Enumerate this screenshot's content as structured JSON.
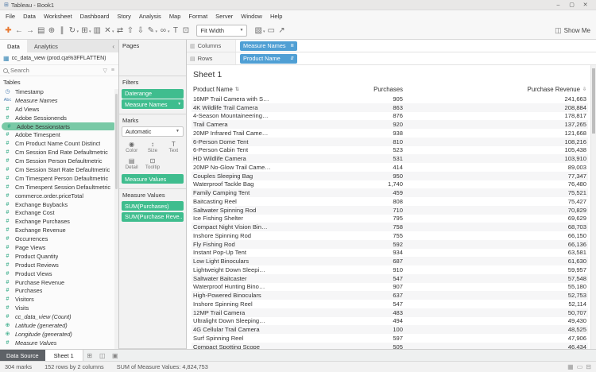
{
  "colors": {
    "green_pill": "#3fbd8e",
    "blue_pill": "#4f9fd4",
    "selected_field_bg": "#79c9a6",
    "measure_icon": "#1ca078",
    "dimension_icon": "#4a7db1"
  },
  "window": {
    "title": "Tableau - Book1"
  },
  "window_controls": {
    "minimize": "–",
    "maximize": "▢",
    "close": "✕"
  },
  "menu": {
    "items": [
      "File",
      "Data",
      "Worksheet",
      "Dashboard",
      "Story",
      "Analysis",
      "Map",
      "Format",
      "Server",
      "Window",
      "Help"
    ]
  },
  "toolbar": {
    "icons_left": [
      {
        "name": "tableau-logo-icon",
        "glyph": "✚",
        "color": "#e8762d"
      },
      {
        "name": "undo-icon",
        "glyph": "←"
      },
      {
        "name": "redo-icon",
        "glyph": "→"
      },
      {
        "name": "save-icon",
        "glyph": "▤"
      },
      {
        "name": "add-data-icon",
        "glyph": "⊕"
      },
      {
        "name": "pause-updates-icon",
        "glyph": "∥"
      },
      {
        "name": "run-update-icon",
        "glyph": "↻",
        "dropdown": true
      },
      {
        "name": "new-worksheet-icon",
        "glyph": "⊞",
        "dropdown": true
      },
      {
        "name": "duplicate-sheet-icon",
        "glyph": "▥"
      },
      {
        "name": "clear-sheet-icon",
        "glyph": "✕",
        "dropdown": true
      },
      {
        "name": "swap-axes-icon",
        "glyph": "⇄"
      },
      {
        "name": "sort-ascending-icon",
        "glyph": "⇧"
      },
      {
        "name": "sort-descending-icon",
        "glyph": "⇩"
      },
      {
        "name": "highlight-icon",
        "glyph": "✎",
        "dropdown": true
      },
      {
        "name": "group-members-icon",
        "glyph": "∞",
        "dropdown": true
      },
      {
        "name": "show-mark-labels-icon",
        "glyph": "T"
      },
      {
        "name": "fix-axes-icon",
        "glyph": "⊡"
      }
    ],
    "fit": {
      "label": "Fit Width"
    },
    "icons_right": [
      {
        "name": "show-hide-cards-icon",
        "glyph": "▧",
        "dropdown": true
      },
      {
        "name": "presentation-mode-icon",
        "glyph": "▭"
      },
      {
        "name": "share-icon",
        "glyph": "↗"
      }
    ],
    "show_me": {
      "label": "Show Me",
      "icon_glyph": "◫"
    }
  },
  "data_panel": {
    "tabs": [
      {
        "label": "Data"
      },
      {
        "label": "Analytics"
      }
    ],
    "collapse_glyph": "‹",
    "datasource": {
      "label": "cc_data_view (prod.cja%3FFLATTEN)"
    },
    "search": {
      "placeholder": "Search"
    },
    "tables_label": "Tables",
    "fields": [
      {
        "icon": "datetime",
        "label": "Timestamp"
      },
      {
        "icon": "abc",
        "label": "Measure Names",
        "italic": true
      },
      {
        "icon": "number",
        "label": "Ad Views"
      },
      {
        "icon": "number",
        "label": "Adobe Sessionends"
      },
      {
        "icon": "number",
        "label": "Adobe Sessionstarts",
        "selected": true
      },
      {
        "icon": "number",
        "label": "Adobe Timespent"
      },
      {
        "icon": "number",
        "label": "Cm Product Name Count Distinct"
      },
      {
        "icon": "number",
        "label": "Cm Session End Rate Defaultmetric"
      },
      {
        "icon": "number",
        "label": "Cm Session Person Defaultmetric"
      },
      {
        "icon": "number",
        "label": "Cm Session Start Rate Defaultmetric"
      },
      {
        "icon": "number",
        "label": "Cm Timespent Person Defaultmetric"
      },
      {
        "icon": "number",
        "label": "Cm Timespent Session Defaultmetric"
      },
      {
        "icon": "number",
        "label": "commerce.order.priceTotal"
      },
      {
        "icon": "number",
        "label": "Exchange Buybacks"
      },
      {
        "icon": "number",
        "label": "Exchange Cost"
      },
      {
        "icon": "number",
        "label": "Exchange Purchases"
      },
      {
        "icon": "number",
        "label": "Exchange Revenue"
      },
      {
        "icon": "number",
        "label": "Occurrences"
      },
      {
        "icon": "number",
        "label": "Page Views"
      },
      {
        "icon": "number",
        "label": "Product Quantity"
      },
      {
        "icon": "number",
        "label": "Product Reviews"
      },
      {
        "icon": "number",
        "label": "Product Views"
      },
      {
        "icon": "number",
        "label": "Purchase Revenue"
      },
      {
        "icon": "number",
        "label": "Purchases"
      },
      {
        "icon": "number",
        "label": "Visitors"
      },
      {
        "icon": "number",
        "label": "Visits"
      },
      {
        "icon": "number",
        "label": "cc_data_view (Count)",
        "italic": true
      },
      {
        "icon": "globe",
        "label": "Latitude (generated)",
        "italic": true
      },
      {
        "icon": "globe",
        "label": "Longitude (generated)",
        "italic": true
      },
      {
        "icon": "number",
        "label": "Measure Values",
        "italic": true
      }
    ]
  },
  "cards": {
    "pages": {
      "label": "Pages"
    },
    "filters": {
      "label": "Filters",
      "pills": [
        {
          "label": "Daterange"
        },
        {
          "label": "Measure Names",
          "icon": "filter"
        }
      ]
    },
    "marks": {
      "label": "Marks",
      "mark_type": "Automatic",
      "buttons": [
        {
          "name": "color-button",
          "label": "Color",
          "glyph": "◉"
        },
        {
          "name": "size-button",
          "label": "Size",
          "glyph": "↕"
        },
        {
          "name": "text-button",
          "label": "Text",
          "glyph": "T"
        },
        {
          "name": "detail-button",
          "label": "Detail",
          "glyph": "▤"
        },
        {
          "name": "tooltip-button",
          "label": "Tooltip",
          "glyph": "⊡"
        }
      ],
      "pill": {
        "label": "Measure Values"
      }
    },
    "measure_values_card": {
      "label": "Measure Values",
      "pills": [
        {
          "label": "SUM(Purchases)"
        },
        {
          "label": "SUM(Purchase Reve.."
        }
      ]
    }
  },
  "columns_shelf": {
    "label": "Columns",
    "pills": [
      {
        "label": "Measure Names"
      }
    ]
  },
  "rows_shelf": {
    "label": "Rows",
    "pills": [
      {
        "label": "Product Name"
      }
    ]
  },
  "sheet": {
    "title": "Sheet 1"
  },
  "chart_data": {
    "type": "table",
    "columns": [
      "Product Name",
      "Purchases",
      "Purchase Revenue"
    ],
    "rows": [
      [
        "16MP Trail Camera with S…",
        "905",
        "241,663"
      ],
      [
        "4K Wildlife Trail Camera",
        "863",
        "208,884"
      ],
      [
        "4-Season Mountaineering…",
        "876",
        "178,817"
      ],
      [
        "Trail Camera",
        "920",
        "137,265"
      ],
      [
        "20MP Infrared Trail Came…",
        "938",
        "121,668"
      ],
      [
        "6-Person Dome Tent",
        "810",
        "108,216"
      ],
      [
        "6-Person Cabin Tent",
        "523",
        "105,438"
      ],
      [
        "HD Wildlife Camera",
        "531",
        "103,910"
      ],
      [
        "20MP No-Glow Trail Came…",
        "414",
        "89,003"
      ],
      [
        "Couples Sleeping Bag",
        "950",
        "77,347"
      ],
      [
        "Waterproof Tackle Bag",
        "1,740",
        "76,480"
      ],
      [
        "Family Camping Tent",
        "459",
        "75,521"
      ],
      [
        "Baitcasting Reel",
        "808",
        "75,427"
      ],
      [
        "Saltwater Spinning Rod",
        "710",
        "70,829"
      ],
      [
        "Ice Fishing Shelter",
        "795",
        "69,629"
      ],
      [
        "Compact Night Vision Bin…",
        "758",
        "68,703"
      ],
      [
        "Inshore Spinning Rod",
        "755",
        "66,150"
      ],
      [
        "Fly Fishing Rod",
        "592",
        "66,136"
      ],
      [
        "Instant Pop-Up Tent",
        "934",
        "63,581"
      ],
      [
        "Low Light Binoculars",
        "687",
        "61,630"
      ],
      [
        "Lightweight Down Sleepi…",
        "910",
        "59,957"
      ],
      [
        "Saltwater Baitcaster",
        "547",
        "57,548"
      ],
      [
        "Waterproof Hunting Bino…",
        "907",
        "55,180"
      ],
      [
        "High-Powered Binoculars",
        "637",
        "52,753"
      ],
      [
        "Inshore Spinning Reel",
        "547",
        "52,114"
      ],
      [
        "12MP Trail Camera",
        "483",
        "50,707"
      ],
      [
        "Ultralight Down Sleeping…",
        "494",
        "49,430"
      ],
      [
        "4G Cellular Trail Camera",
        "100",
        "48,525"
      ],
      [
        "Surf Spinning Reel",
        "597",
        "47,906"
      ],
      [
        "Compact Spotting Scope",
        "505",
        "46,434"
      ]
    ]
  },
  "bottom_tabs": {
    "data_source_label": "Data Source",
    "sheets": [
      {
        "label": "Sheet 1",
        "active": true
      }
    ],
    "new_icons": [
      {
        "name": "new-worksheet-tab-icon",
        "glyph": "⊞"
      },
      {
        "name": "new-dashboard-tab-icon",
        "glyph": "◫"
      },
      {
        "name": "new-story-tab-icon",
        "glyph": "▣"
      }
    ]
  },
  "status_bar": {
    "marks": "304 marks",
    "size": "152 rows by 2 columns",
    "aggregate": "SUM of Measure Values: 4,824,753",
    "view_icons": [
      {
        "name": "sheet-tabs-view-icon",
        "glyph": "▦"
      },
      {
        "name": "filmstrip-view-icon",
        "glyph": "▭"
      },
      {
        "name": "sheet-sorter-view-icon",
        "glyph": "⊟"
      }
    ]
  }
}
